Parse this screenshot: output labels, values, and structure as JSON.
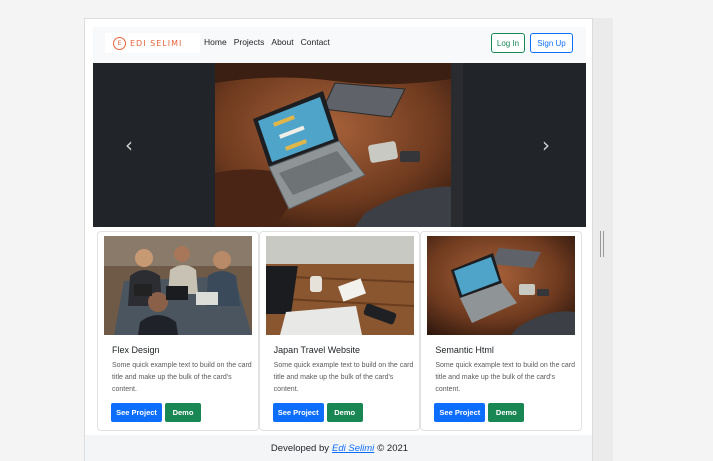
{
  "navbar": {
    "brand_text": "EDI SELIMI",
    "brand_mark": "E",
    "links": [
      "Home",
      "Projects",
      "About",
      "Contact"
    ],
    "login_label": "Log In",
    "signup_label": "Sign Up"
  },
  "carousel": {
    "prev_glyph": "‹",
    "next_glyph": "›"
  },
  "cards": [
    {
      "title": "Flex Design",
      "text": "Some quick example text to build on the card title and make up the bulk of the card's content.",
      "project_label": "See Project",
      "demo_label": "Demo"
    },
    {
      "title": "Japan Travel Website",
      "text": "Some quick example text to build on the card title and make up the bulk of the card's content.",
      "project_label": "See Project",
      "demo_label": "Demo"
    },
    {
      "title": "Semantic Html",
      "text": "Some quick example text to build on the card title and make up the bulk of the card's content.",
      "project_label": "See Project",
      "demo_label": "Demo"
    }
  ],
  "footer": {
    "prefix": "Developed by",
    "author": "Edi Selimi",
    "suffix": "© 2021"
  },
  "colors": {
    "primary": "#0d6efd",
    "success": "#198754",
    "brand": "#e8623a",
    "dark": "#212529"
  }
}
